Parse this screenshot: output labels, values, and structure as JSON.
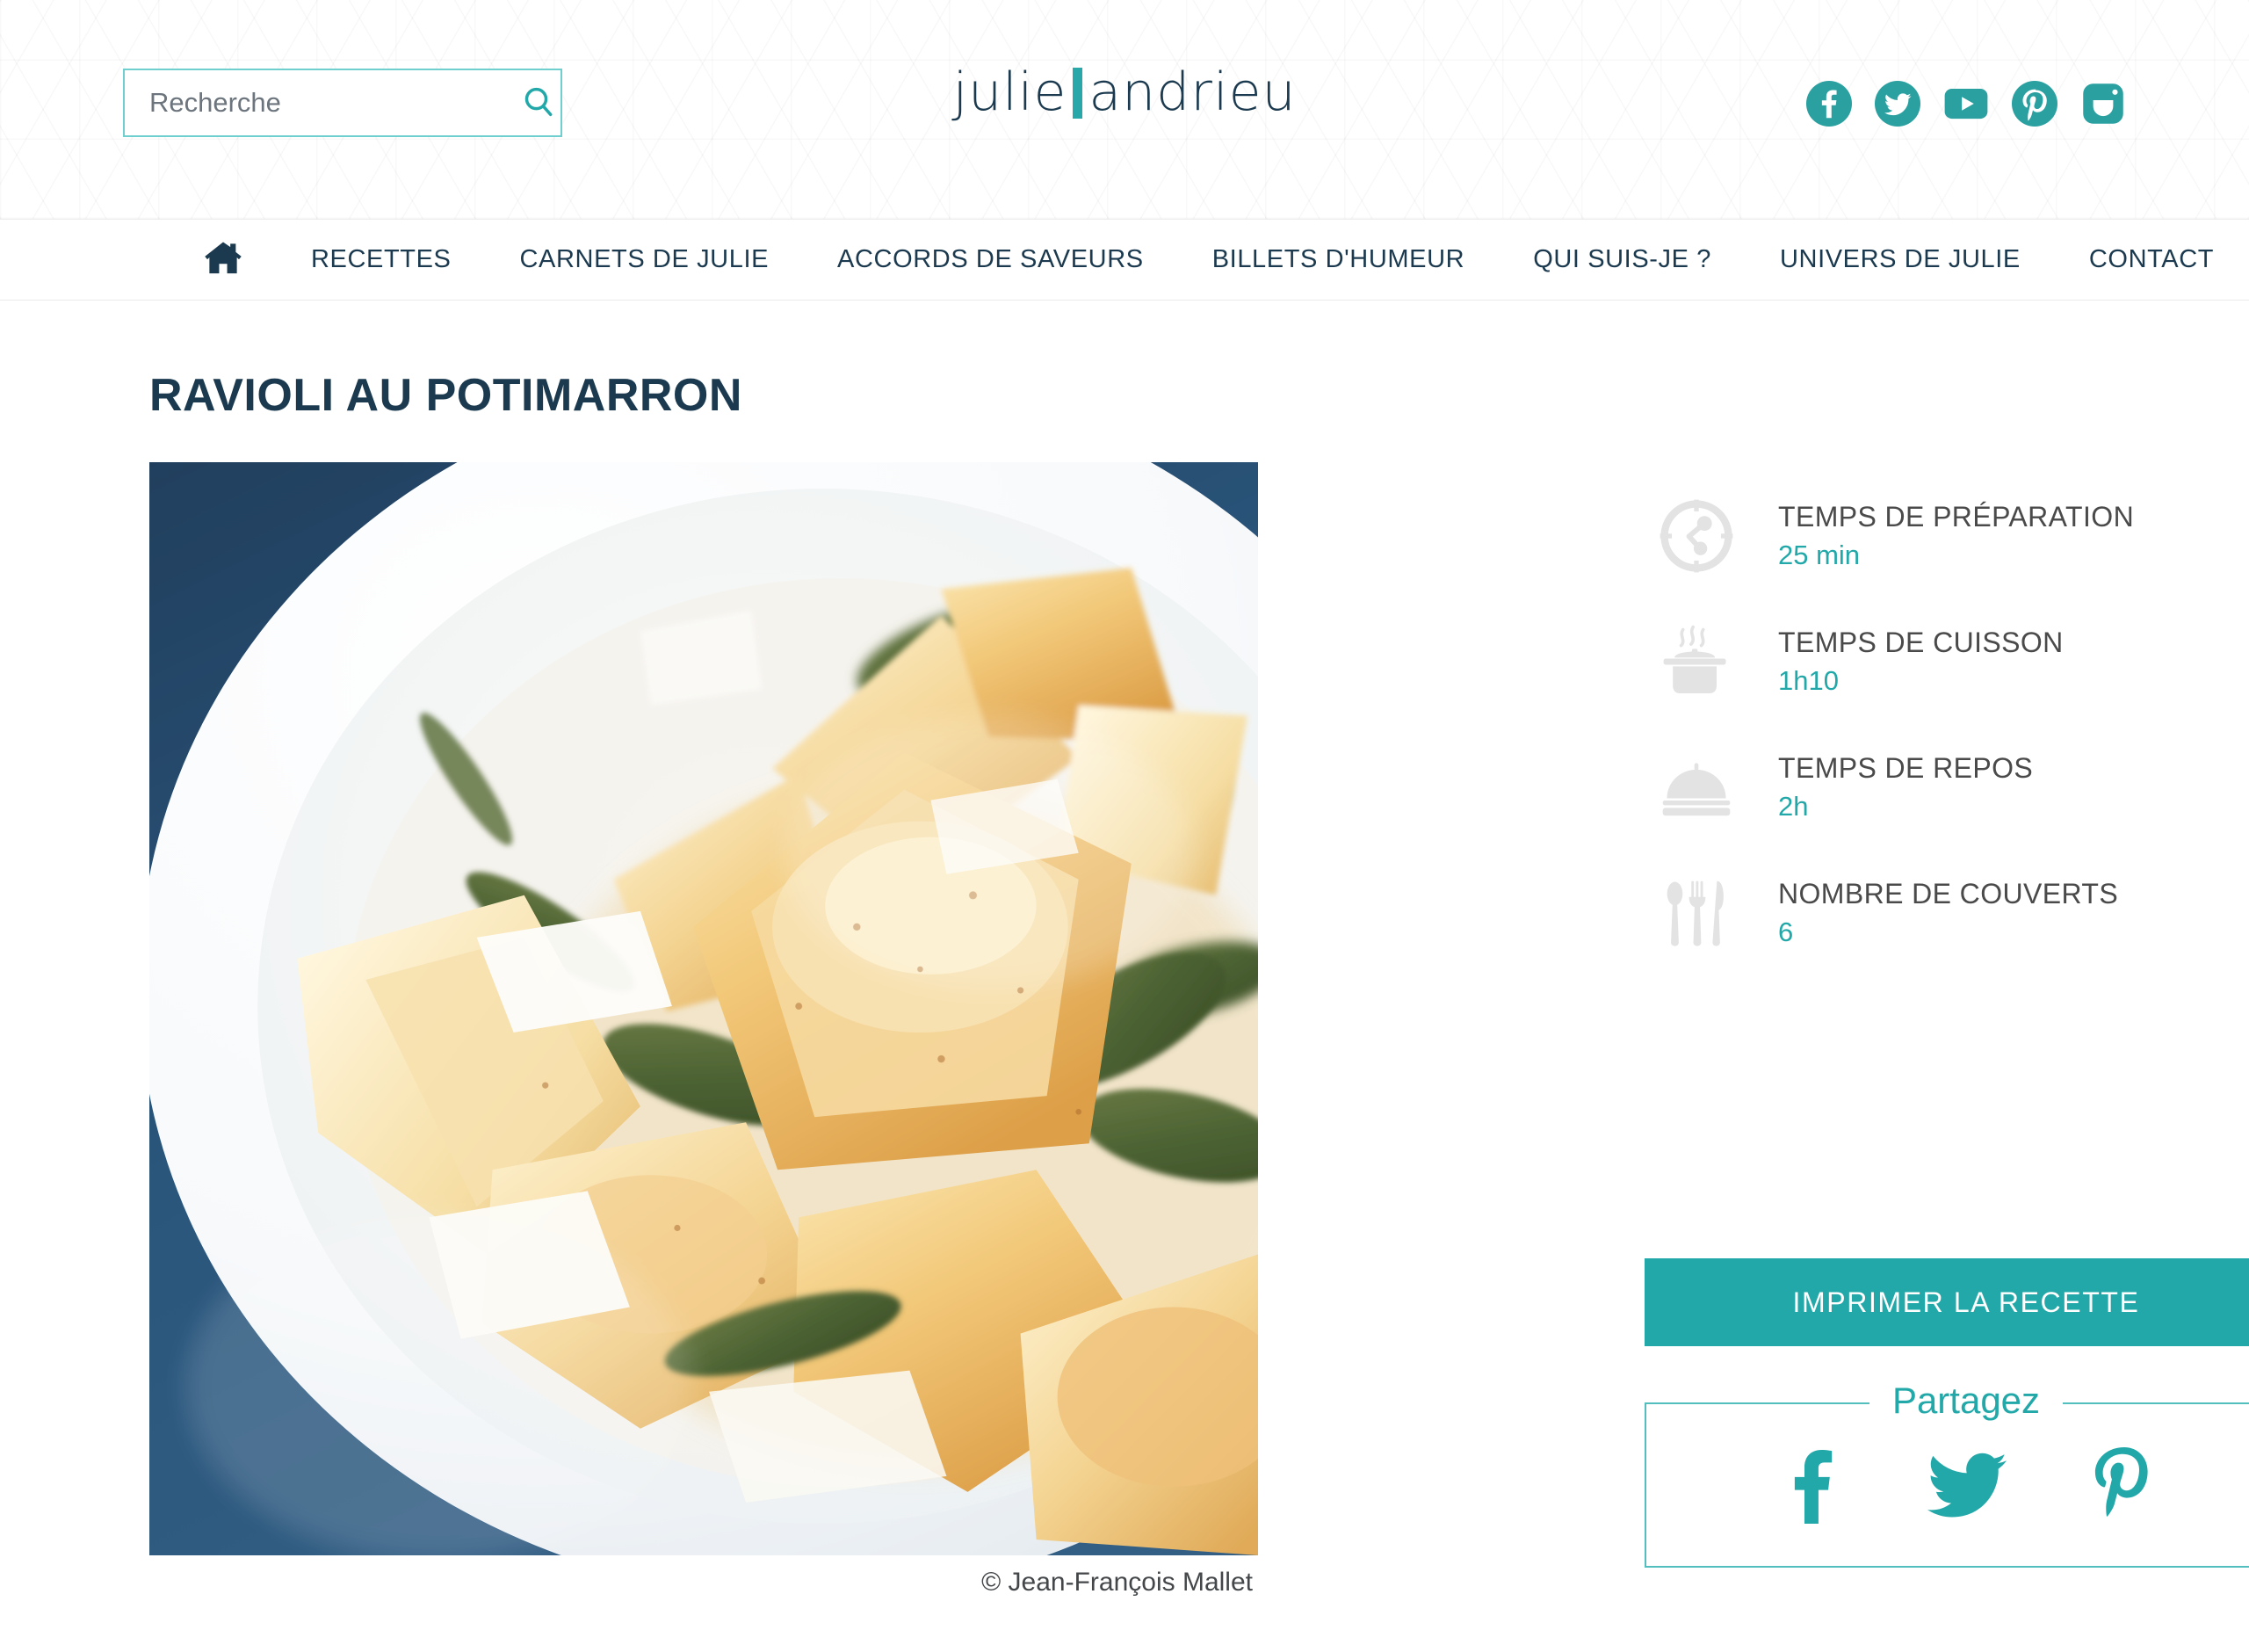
{
  "colors": {
    "teal": "#22a8a8",
    "teal_light": "#52bebe",
    "navy": "#1b3a4f",
    "gray_icon": "#e2e2e2",
    "label_gray": "#4a4a4a"
  },
  "header": {
    "search": {
      "placeholder": "Recherche",
      "value": "",
      "button_label": "",
      "icon": "search-icon"
    },
    "logo": {
      "first": "julie",
      "separator": "|",
      "second": "andrieu"
    },
    "social_links": [
      {
        "name": "facebook",
        "icon": "facebook-icon"
      },
      {
        "name": "twitter",
        "icon": "twitter-icon"
      },
      {
        "name": "youtube",
        "icon": "youtube-icon"
      },
      {
        "name": "pinterest",
        "icon": "pinterest-icon"
      },
      {
        "name": "instagram",
        "icon": "instagram-icon"
      }
    ]
  },
  "nav": {
    "home_icon": "home-icon",
    "items": [
      {
        "label": "RECETTES"
      },
      {
        "label": "CARNETS DE JULIE"
      },
      {
        "label": "ACCORDS DE SAVEURS"
      },
      {
        "label": "BILLETS D'HUMEUR"
      },
      {
        "label": "QUI SUIS-JE ?"
      },
      {
        "label": "UNIVERS DE JULIE"
      },
      {
        "label": "CONTACT"
      }
    ]
  },
  "recipe": {
    "title": "RAVIOLI AU POTIMARRON",
    "photo_caption": "© Jean-François Mallet",
    "photo_alt": "Assiette de ravioli au potimarron avec feuilles de sauge et copeaux de parmesan",
    "info": [
      {
        "icon": "clock-icon",
        "label": "TEMPS DE PRÉPARATION",
        "value": "25 min"
      },
      {
        "icon": "pot-icon",
        "label": "TEMPS DE CUISSON",
        "value": "1h10"
      },
      {
        "icon": "cloche-icon",
        "label": "TEMPS DE REPOS",
        "value": "2h"
      },
      {
        "icon": "cutlery-icon",
        "label": "NOMBRE DE COUVERTS",
        "value": "6"
      }
    ],
    "print_button": "IMPRIMER LA RECETTE",
    "share": {
      "title": "Partagez",
      "buttons": [
        {
          "name": "facebook",
          "icon": "facebook-share-icon"
        },
        {
          "name": "twitter",
          "icon": "twitter-share-icon"
        },
        {
          "name": "pinterest",
          "icon": "pinterest-share-icon"
        }
      ]
    }
  }
}
